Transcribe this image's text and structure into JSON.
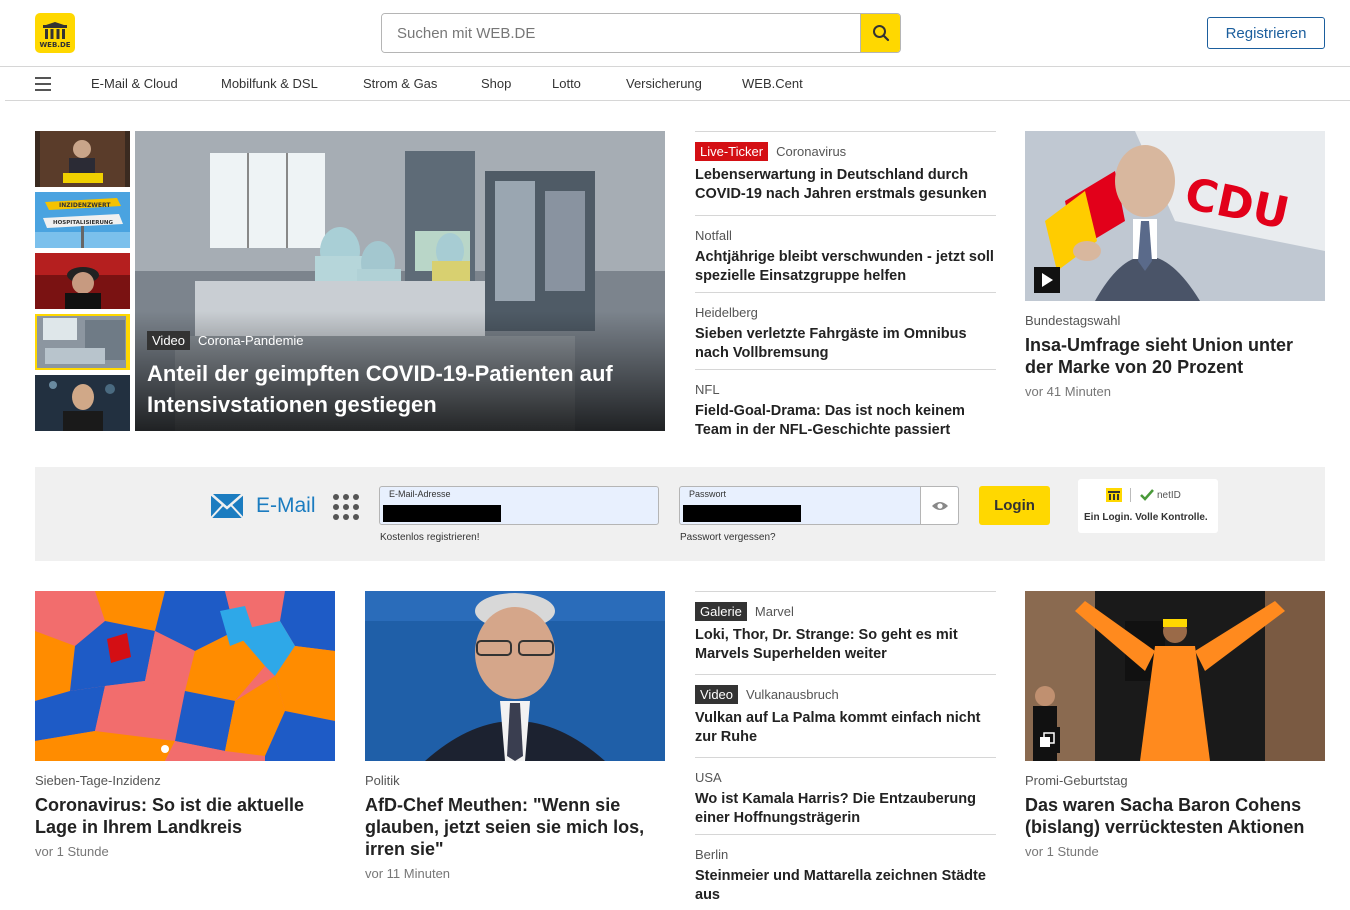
{
  "header": {
    "logo_text": "WEB.DE",
    "search_placeholder": "Suchen mit WEB.DE",
    "register_label": "Registrieren"
  },
  "nav": {
    "items": [
      "E-Mail & Cloud",
      "Mobilfunk & DSL",
      "Strom & Gas",
      "Shop",
      "Lotto",
      "Versicherung",
      "WEB.Cent"
    ]
  },
  "hero": {
    "badge": "Video",
    "kicker": "Corona-Pandemie",
    "title": "Anteil der geimpften COVID-19-Patienten auf Intensivstationen gestiegen"
  },
  "top_news": [
    {
      "badge": "Live-Ticker",
      "kicker": "Coronavirus",
      "title": "Lebenserwartung in Deutschland durch COVID-19 nach Jahren erstmals gesunken"
    },
    {
      "kicker": "Notfall",
      "title": "Achtjährige bleibt verschwunden - jetzt soll spezielle Einsatzgruppe helfen"
    },
    {
      "kicker": "Heidelberg",
      "title": "Sieben verletzte Fahrgäste im Omnibus nach Vollbremsung"
    },
    {
      "kicker": "NFL",
      "title": "Field-Goal-Drama: Das ist noch keinem Team in der NFL-Geschichte passiert"
    }
  ],
  "card_right_top": {
    "kicker": "Bundestagswahl",
    "title": "Insa-Umfrage sieht Union unter der Marke von 20 Prozent",
    "time": "vor 41 Minuten",
    "image_text": "CDU"
  },
  "login": {
    "service_label": "E-Mail",
    "email_label": "E-Mail-Adresse",
    "password_label": "Passwort",
    "register_link": "Kostenlos registrieren!",
    "forgot_link": "Passwort vergessen?",
    "login_label": "Login",
    "netid_label": "netID",
    "netid_claim": "Ein Login. Volle Kontrolle."
  },
  "bottom_cards": [
    {
      "kicker": "Sieben-Tage-Inzidenz",
      "title": "Coronavirus: So ist die aktuelle Lage in Ihrem Landkreis",
      "time": "vor 1 Stunde"
    },
    {
      "kicker": "Politik",
      "title": "AfD-Chef Meuthen: \"Wenn sie glauben, jetzt seien sie mich los, irren sie\"",
      "time": "vor 11 Minuten"
    },
    {
      "kicker": "Promi-Geburtstag",
      "title": "Das waren Sacha Baron Cohens (bislang) verrücktesten Aktionen",
      "time": "vor 1 Stunde"
    }
  ],
  "bottom_news": [
    {
      "badge": "Galerie",
      "kicker": "Marvel",
      "title": "Loki, Thor, Dr. Strange: So geht es mit Marvels Superhelden weiter"
    },
    {
      "badge": "Video",
      "kicker": "Vulkanausbruch",
      "title": "Vulkan auf La Palma kommt einfach nicht zur Ruhe"
    },
    {
      "kicker": "USA",
      "title": "Wo ist Kamala Harris? Die Entzauberung einer Hoffnungsträgerin"
    },
    {
      "kicker": "Berlin",
      "title": "Steinmeier und Mattarella zeichnen Städte aus"
    }
  ],
  "thumb_texts": {
    "inzidenz": "INZIDENZWERT",
    "hospital": "HOSPITALISIERUNG"
  },
  "colors": {
    "brand_yellow": "#ffd800",
    "link_blue": "#1b5e9d",
    "live_red": "#d40f14",
    "mail_blue": "#1b7cc0"
  }
}
